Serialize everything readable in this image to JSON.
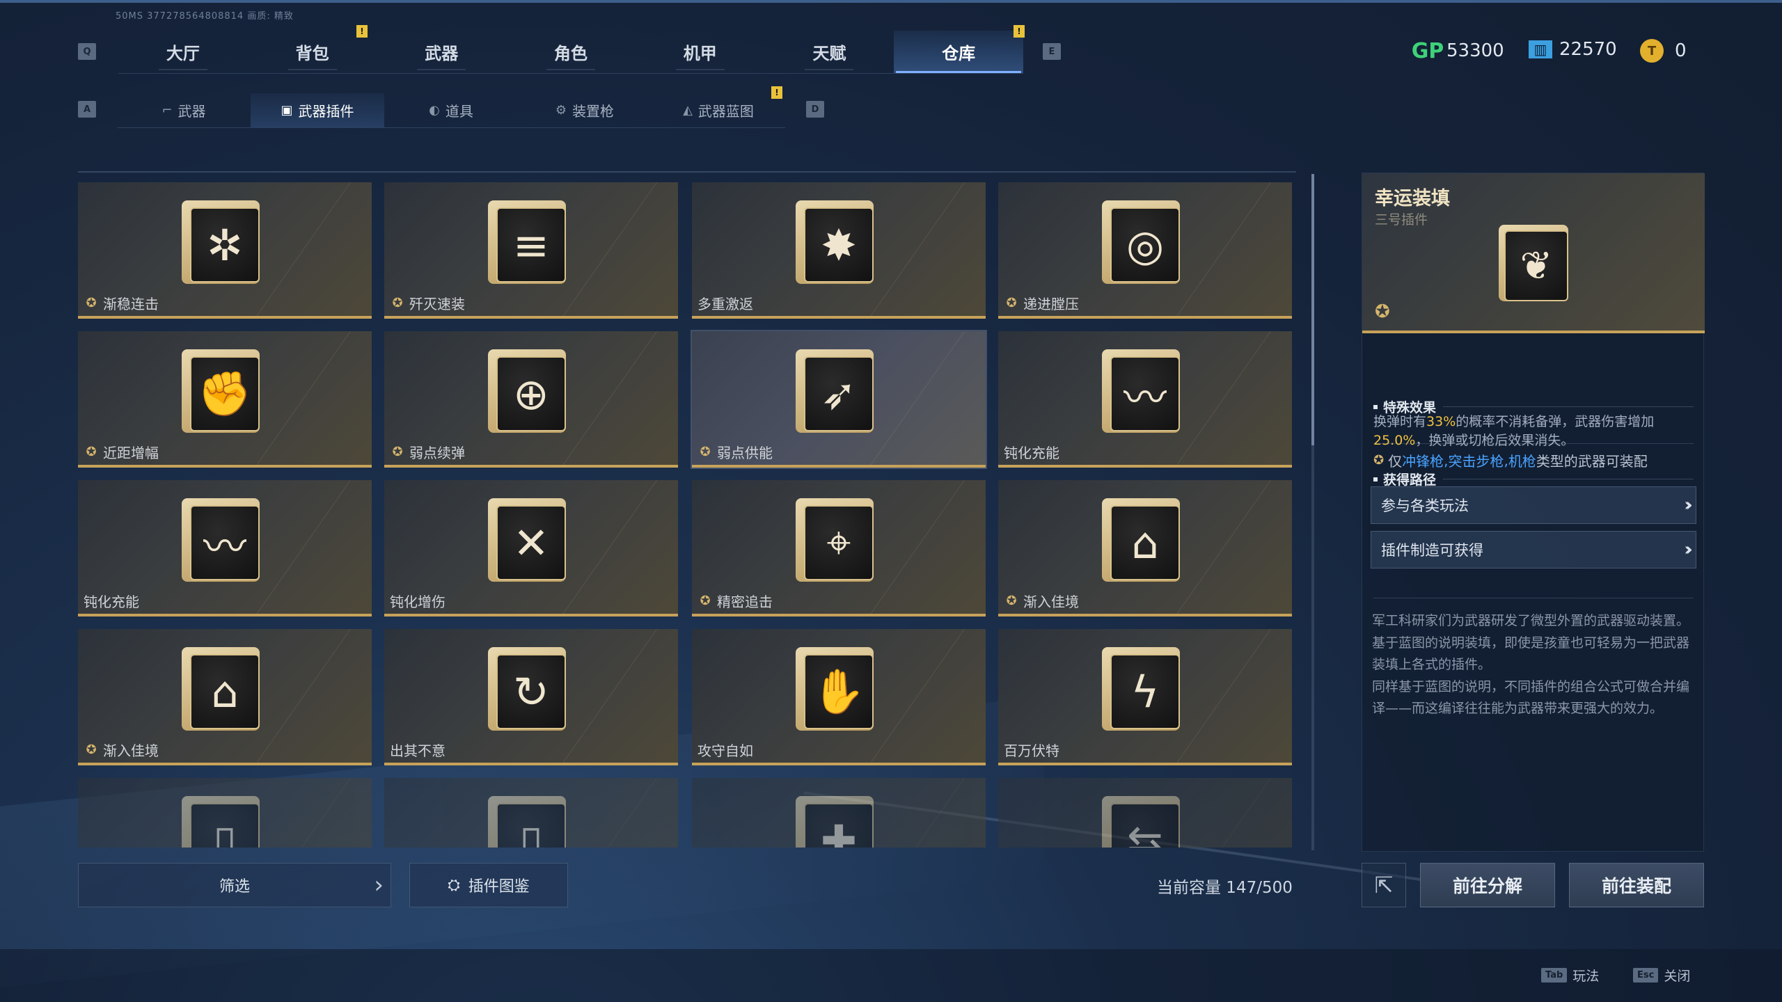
{
  "version_text": "50MS  377278564808814     画质: 精致",
  "top_tabs": {
    "key_left": "Q",
    "key_right": "E",
    "items": [
      {
        "label": "大厅"
      },
      {
        "label": "背包"
      },
      {
        "label": "武器"
      },
      {
        "label": "角色"
      },
      {
        "label": "机甲"
      },
      {
        "label": "天赋"
      },
      {
        "label": "仓库"
      }
    ],
    "active": "仓库"
  },
  "currencies": {
    "gp": {
      "icon": "gp-icon",
      "label": "GP",
      "value": "53300"
    },
    "ticket": {
      "icon": "ticket-icon",
      "value": "22570"
    },
    "coin": {
      "icon": "coin-icon",
      "value": "0"
    }
  },
  "sub_tabs": {
    "key_left": "A",
    "key_right": "D",
    "items": [
      {
        "label": "武器",
        "icon": "gun-icon"
      },
      {
        "label": "武器插件",
        "icon": "plugin-icon"
      },
      {
        "label": "道具",
        "icon": "item-icon"
      },
      {
        "label": "装置枪",
        "icon": "device-gun-icon"
      },
      {
        "label": "武器蓝图",
        "icon": "blueprint-icon"
      }
    ],
    "active": "武器插件"
  },
  "alert_mark": "!",
  "plugins": [
    {
      "name": "渐稳连击",
      "glyph": "✲",
      "badge": true
    },
    {
      "name": "歼灭速装",
      "glyph": "≡",
      "badge": true
    },
    {
      "name": "多重激返",
      "glyph": "✸",
      "badge": false
    },
    {
      "name": "递进膛压",
      "glyph": "◎",
      "badge": true
    },
    {
      "name": "近距增幅",
      "glyph": "✊",
      "badge": true
    },
    {
      "name": "弱点续弹",
      "glyph": "⊕",
      "badge": true
    },
    {
      "name": "弱点供能",
      "glyph": "➶",
      "badge": true
    },
    {
      "name": "钝化充能",
      "glyph": "〰",
      "badge": false
    },
    {
      "name": "钝化充能",
      "glyph": "〰",
      "badge": false
    },
    {
      "name": "钝化增伤",
      "glyph": "✕",
      "badge": false
    },
    {
      "name": "精密追击",
      "glyph": "⌖",
      "badge": true
    },
    {
      "name": "渐入佳境",
      "glyph": "⌂",
      "badge": true
    },
    {
      "name": "渐入佳境",
      "glyph": "⌂",
      "badge": true
    },
    {
      "name": "出其不意",
      "glyph": "↻",
      "badge": false
    },
    {
      "name": "攻守自如",
      "glyph": "✋",
      "badge": false
    },
    {
      "name": "百万伏特",
      "glyph": "ϟ",
      "badge": false
    }
  ],
  "badge_glyph": "✪",
  "partial_row_glyphs": [
    "▯",
    "▯",
    "✚",
    "⇆"
  ],
  "filter": {
    "label": "筛选",
    "chevron": "›"
  },
  "codex": {
    "label": "插件图鉴",
    "icon": "codex-icon",
    "glyph": "⛭"
  },
  "capacity": "当前容量 147/500",
  "detail": {
    "title": "幸运装填",
    "subtitle": "三号插件",
    "icon_glyph": "❦",
    "badge_glyph": "✪",
    "section_effect": "特殊效果",
    "effect_parts": {
      "p1": "换弹时有",
      "h1": "33%",
      "p2": "的概率不消耗备弹，武器伤害增加",
      "h2": "25.0%",
      "p3": "，换弹或切枪后效果消失。"
    },
    "restrict_parts": {
      "p1": "仅",
      "w1": "冲锋枪",
      "sep1": ",",
      "w2": "突击步枪",
      "sep2": ",",
      "w3": "机枪",
      "p2": "类型的武器可装配"
    },
    "section_route": "获得路径",
    "routes": [
      {
        "label": "参与各类玩法"
      },
      {
        "label": "插件制造可获得"
      }
    ],
    "route_chevron": "››",
    "lore": "军工科研家们为武器研发了微型外置的武器驱动装置。\n基于蓝图的说明装填，即使是孩童也可轻易为一把武器装填上各式的插件。\n同样基于蓝图的说明，不同插件的组合公式可做合并编译——而这编译往往能为武器带来更强大的效力。"
  },
  "actions": {
    "external_glyph": "⇱",
    "dismantle": "前往分解",
    "equip": "前往装配"
  },
  "hints": [
    {
      "key": "Tab",
      "label": "玩法"
    },
    {
      "key": "Esc",
      "label": "关闭"
    }
  ],
  "colors": {
    "accent_gold": "#c7a25a",
    "highlight_yellow": "#f0c23d",
    "highlight_blue": "#4aa3ff",
    "gp_green": "#3ed27a"
  }
}
